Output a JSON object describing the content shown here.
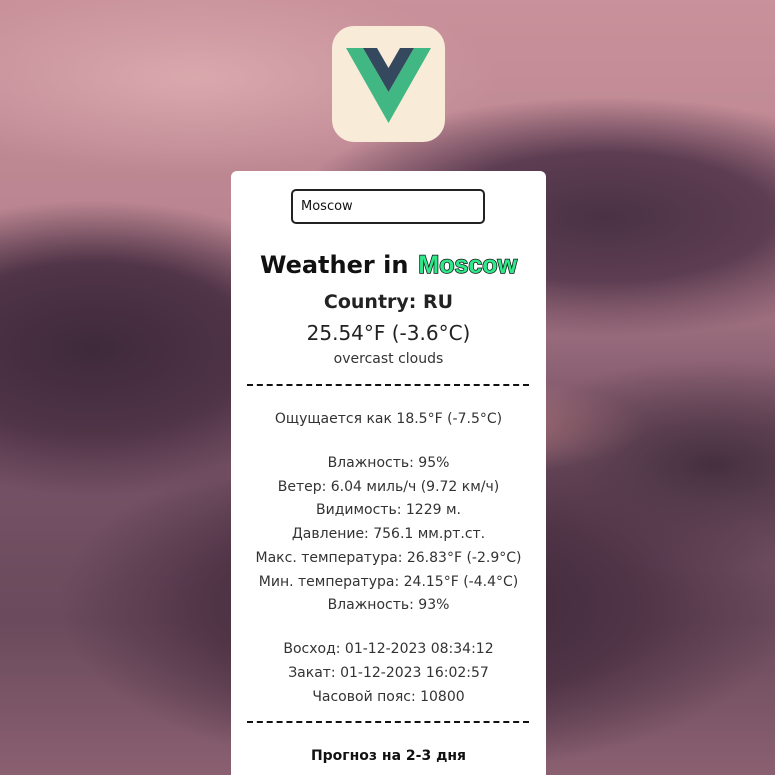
{
  "search": {
    "value": "Moscow"
  },
  "weather": {
    "heading_prefix": "Weather in",
    "city": "Moscow",
    "country": "Country: RU",
    "temperature": "25.54°F (-3.6°C)",
    "description": "overcast clouds"
  },
  "details": {
    "feels_like": "Ощущается как 18.5°F (-7.5°C)",
    "humidity": "Влажность: 95%",
    "wind": "Ветер: 6.04 миль/ч (9.72 км/ч)",
    "visibility": "Видимость: 1229 м.",
    "pressure": "Давление: 756.1 мм.рт.ст.",
    "temp_max": "Макс. температура: 26.83°F (-2.9°C)",
    "temp_min": "Мин. температура: 24.15°F (-4.4°C)",
    "humidity_2": "Влажность: 93%"
  },
  "sun": {
    "sunrise": "Восход: 01-12-2023 08:34:12",
    "sunset": "Закат: 01-12-2023 16:02:57",
    "timezone": "Часовой пояс: 10800"
  },
  "forecast": {
    "title": "Прогноз на 2-3 дня"
  },
  "colors": {
    "city_highlight": "#2ee88a",
    "logo_green": "#41b883",
    "logo_dark": "#35495e",
    "logo_bg": "#f8ecd9"
  }
}
